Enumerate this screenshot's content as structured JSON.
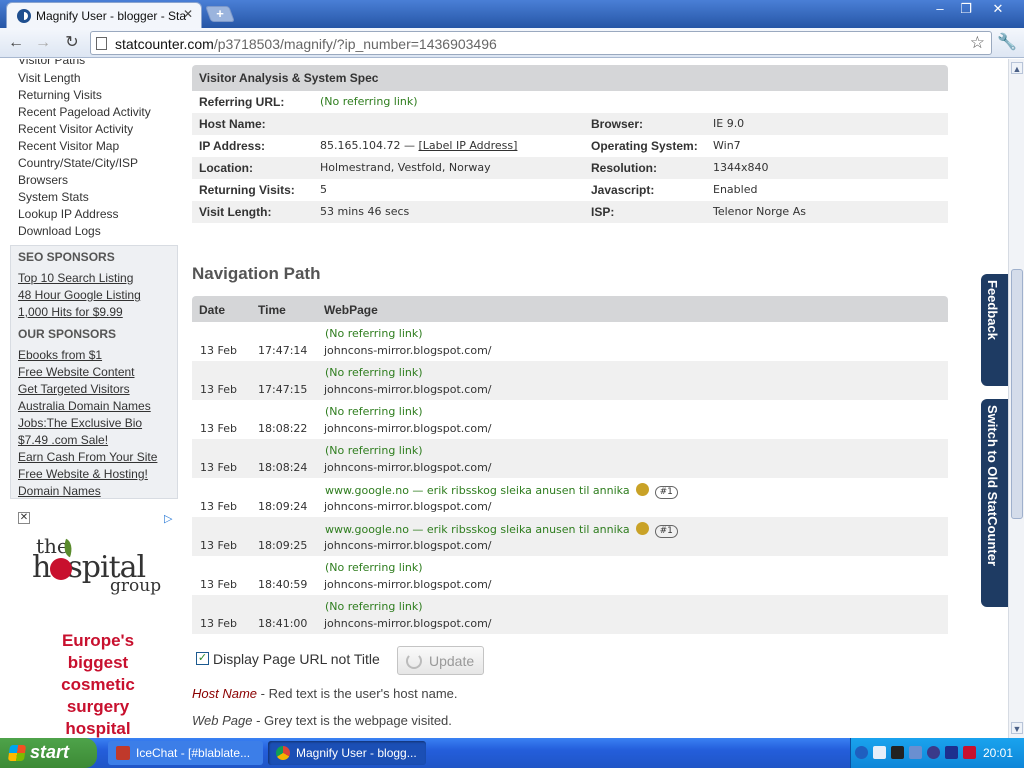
{
  "browser": {
    "tab_title": "Magnify User - blogger - StatC",
    "tab_close": "✕",
    "new_tab": "+",
    "url_domain": "statcounter.com",
    "url_path": "/p3718503/magnify/?ip_number=1436903496",
    "window_controls": {
      "minimize": "–",
      "restore": "❐",
      "close": "✕"
    },
    "nav": {
      "back": "←",
      "forward": "→",
      "reload": "↻",
      "star": "☆",
      "wrench": "🔧"
    }
  },
  "sidebar": {
    "menu": [
      "Visitor Paths",
      "Visit Length",
      "Returning Visits",
      "Recent Pageload Activity",
      "Recent Visitor Activity",
      "Recent Visitor Map",
      "Country/State/City/ISP",
      "Browsers",
      "System Stats",
      "Lookup IP Address",
      "Download Logs"
    ],
    "seo_title": "SEO SPONSORS",
    "seo_links": [
      "Top 10 Search Listing",
      "48 Hour Google Listing",
      "1,000 Hits for $9.99"
    ],
    "our_title": "OUR SPONSORS",
    "our_links": [
      "Ebooks from $1",
      "Free Website Content",
      "Get Targeted Visitors",
      "Australia Domain Names",
      "Jobs:The Exclusive Bio",
      "$7.49 .com Sale!",
      "Earn Cash From Your Site",
      "Free Website & Hosting!",
      "Domain Names"
    ],
    "ad": {
      "close": "✕",
      "info": "▷",
      "logo_the": "the",
      "logo_main": "hospital",
      "logo_group": "group",
      "slogan": [
        "Europe's",
        "biggest",
        "cosmetic",
        "surgery",
        "hospital"
      ]
    }
  },
  "analysis": {
    "title": "Visitor Analysis & System Spec",
    "referring_label": "Referring URL:",
    "referring_value": "(No referring link)",
    "host_label": "Host Name:",
    "host_value": "",
    "ip_label": "IP Address:",
    "ip_value": "85.165.104.72 —",
    "ip_link": "[Label IP Address]",
    "location_label": "Location:",
    "location_value": "Holmestrand, Vestfold, Norway",
    "returning_label": "Returning Visits:",
    "returning_value": "5",
    "length_label": "Visit Length:",
    "length_value": "53 mins 46 secs",
    "browser_label": "Browser:",
    "browser_value": "IE 9.0",
    "os_label": "Operating System:",
    "os_value": "Win7",
    "resolution_label": "Resolution:",
    "resolution_value": "1344x840",
    "js_label": "Javascript:",
    "js_value": "Enabled",
    "isp_label": "ISP:",
    "isp_value": "Telenor Norge As"
  },
  "navigation": {
    "title": "Navigation Path",
    "columns": {
      "date": "Date",
      "time": "Time",
      "webpage": "WebPage"
    },
    "rows": [
      {
        "date": "13 Feb",
        "time": "17:47:14",
        "referrer": "(No referring link)",
        "page": "johncons-mirror.blogspot.com/"
      },
      {
        "date": "13 Feb",
        "time": "17:47:15",
        "referrer": "(No referring link)",
        "page": "johncons-mirror.blogspot.com/"
      },
      {
        "date": "13 Feb",
        "time": "18:08:22",
        "referrer": "(No referring link)",
        "page": "johncons-mirror.blogspot.com/"
      },
      {
        "date": "13 Feb",
        "time": "18:08:24",
        "referrer": "(No referring link)",
        "page": "johncons-mirror.blogspot.com/"
      },
      {
        "date": "13 Feb",
        "time": "18:09:24",
        "referrer": "www.google.no — erik ribsskog sleika anusen til annika",
        "page": "johncons-mirror.blogspot.com/",
        "rank": "#1"
      },
      {
        "date": "13 Feb",
        "time": "18:09:25",
        "referrer": "www.google.no — erik ribsskog sleika anusen til annika",
        "page": "johncons-mirror.blogspot.com/",
        "rank": "#1"
      },
      {
        "date": "13 Feb",
        "time": "18:40:59",
        "referrer": "(No referring link)",
        "page": "johncons-mirror.blogspot.com/"
      },
      {
        "date": "13 Feb",
        "time": "18:41:00",
        "referrer": "(No referring link)",
        "page": "johncons-mirror.blogspot.com/"
      }
    ]
  },
  "controls": {
    "checkbox_checked": true,
    "checkbox_mark": "✓",
    "checkbox_label": "Display Page URL not Title",
    "update_label": "Update"
  },
  "legend": {
    "host_term": "Host Name",
    "host_desc": " - Red text is the user's host name.",
    "web_term": "Web Page",
    "web_desc": " - Grey text is the webpage visited."
  },
  "side_tabs": {
    "feedback": "Feedback",
    "switch": "Switch to Old StatCounter"
  },
  "taskbar": {
    "start": "start",
    "tasks": [
      "IceChat - [#blablate...",
      "Magnify User - blogg..."
    ],
    "clock": "20:01"
  },
  "colors": {
    "referrer_green": "#2e7d1e",
    "host_red": "#8b0000",
    "side_tab_navy": "#1e3b63",
    "panel_header_gray": "#d5d6d8"
  }
}
